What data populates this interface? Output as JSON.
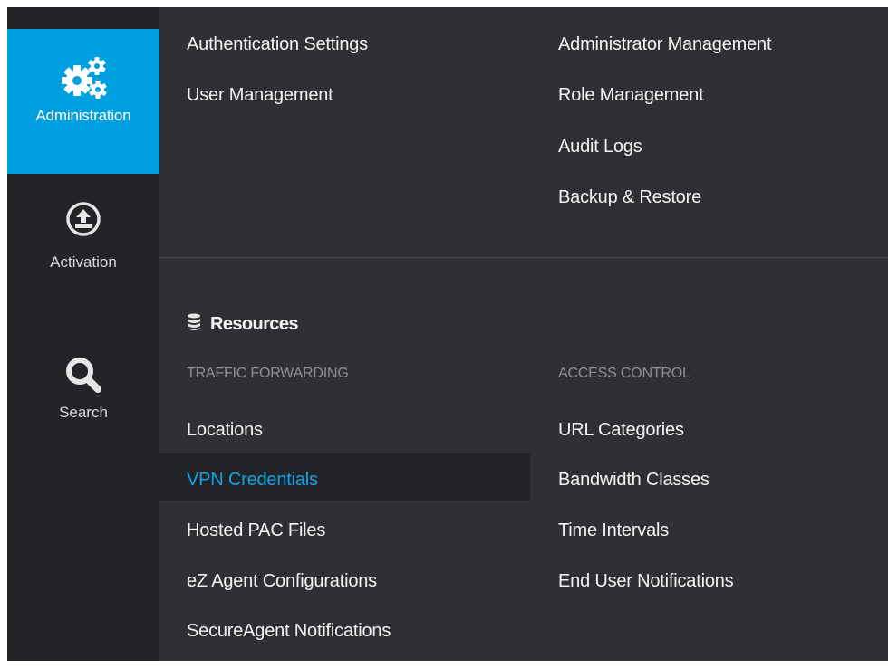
{
  "nav": {
    "items": [
      {
        "label": "Administration",
        "icon": "gears-icon",
        "active": true
      },
      {
        "label": "Activation",
        "icon": "upload-circle-icon",
        "active": false
      },
      {
        "label": "Search",
        "icon": "search-icon",
        "active": false
      }
    ]
  },
  "menu": {
    "admin_left": [
      "Authentication Settings",
      "User Management"
    ],
    "admin_right": [
      "Administrator Management",
      "Role Management",
      "Audit Logs",
      "Backup & Restore"
    ],
    "resources": {
      "title": "Resources",
      "icon": "database-icon",
      "traffic_forwarding": {
        "heading": "TRAFFIC FORWARDING",
        "items": [
          "Locations",
          "VPN Credentials",
          "Hosted PAC Files",
          "eZ Agent Configurations",
          "SecureAgent Notifications"
        ],
        "active": "VPN Credentials"
      },
      "access_control": {
        "heading": "ACCESS CONTROL",
        "items": [
          "URL Categories",
          "Bandwidth Classes",
          "Time Intervals",
          "End User Notifications"
        ]
      }
    }
  },
  "colors": {
    "accent": "#009fdf",
    "active_link": "#12a3e6",
    "panel_bg": "#2f3033",
    "rail_bg": "#232428"
  }
}
